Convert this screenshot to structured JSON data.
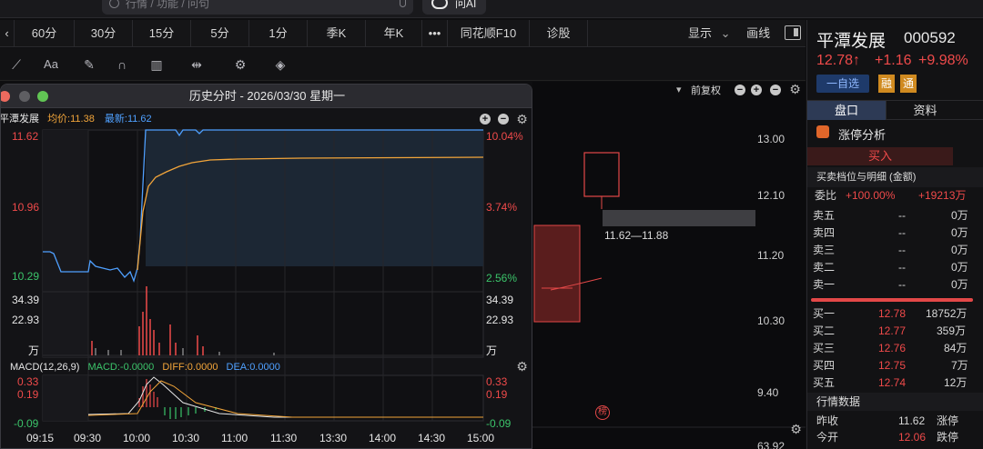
{
  "search": {
    "placeholder": "行情 / 功能 / 问句"
  },
  "ask_ai": {
    "label": "问AI"
  },
  "period_tabs": [
    "60分",
    "30分",
    "15分",
    "5分",
    "1分",
    "季K",
    "年K",
    "•••",
    "同花顺F10",
    "诊股"
  ],
  "toolbar_right": {
    "display_label": "显示",
    "drawline_label": "画线"
  },
  "kline": {
    "restore_label": "前复权",
    "price_ticks": [
      "13.00",
      "12.10",
      "11.20",
      "10.30",
      "9.40",
      "63.92"
    ],
    "range_label": "11.62—11.88",
    "badge": "榜"
  },
  "popup": {
    "title": "历史分时 - 2026/03/30 星期一",
    "stock_name": "平潭发展",
    "avg_label": "均价:11.38",
    "last_label": "最新:11.62",
    "left_ticks": [
      "11.62",
      "10.96",
      "10.29"
    ],
    "right_pct": [
      "10.04%",
      "3.74%",
      "2.56%"
    ],
    "vol_ticks": [
      "34.39",
      "22.93",
      "万"
    ],
    "macd_label": "MACD(12,26,9)",
    "macd_value": "MACD:-0.0000",
    "diff_value": "DIFF:0.0000",
    "dea_value": "DEA:0.0000",
    "macd_ticks": [
      "0.33",
      "0.19",
      "-0.09"
    ],
    "time_labels": [
      "09:15",
      "09:30",
      "10:00",
      "10:30",
      "11:00",
      "11:30",
      "13:30",
      "14:00",
      "14:30",
      "15:00"
    ]
  },
  "quote": {
    "name": "平潭发展",
    "code": "000592",
    "price": "12.78↑",
    "change": "+1.16",
    "pct": "+9.98%",
    "watch_btn": "一自选",
    "rong": "融",
    "tong": "通",
    "tab_book": "盘口",
    "tab_info": "资料",
    "limit_analysis": "涨停分析",
    "buy_label": "买入",
    "detail_title": "买卖档位与明细 (金额)",
    "weibi_label": "委比",
    "weibi_pct": "+100.00%",
    "weibi_amt": "+19213万",
    "asks": [
      {
        "label": "卖五",
        "price": "--",
        "amt": "0万"
      },
      {
        "label": "卖四",
        "price": "--",
        "amt": "0万"
      },
      {
        "label": "卖三",
        "price": "--",
        "amt": "0万"
      },
      {
        "label": "卖二",
        "price": "--",
        "amt": "0万"
      },
      {
        "label": "卖一",
        "price": "--",
        "amt": "0万"
      }
    ],
    "bids": [
      {
        "label": "买一",
        "price": "12.78",
        "amt": "18752万"
      },
      {
        "label": "买二",
        "price": "12.77",
        "amt": "359万"
      },
      {
        "label": "买三",
        "price": "12.76",
        "amt": "84万"
      },
      {
        "label": "买四",
        "price": "12.75",
        "amt": "7万"
      },
      {
        "label": "买五",
        "price": "12.74",
        "amt": "12万"
      }
    ],
    "market_title": "行情数据",
    "prev_close_label": "昨收",
    "prev_close": "11.62",
    "limit_up_label": "涨停",
    "open_label": "今开",
    "open": "12.06",
    "limit_down_label": "跌停"
  },
  "colors": {
    "up": "#ef4a4a",
    "down": "#3bc46a",
    "avg": "#f2a53a",
    "last": "#4fa0ff"
  }
}
